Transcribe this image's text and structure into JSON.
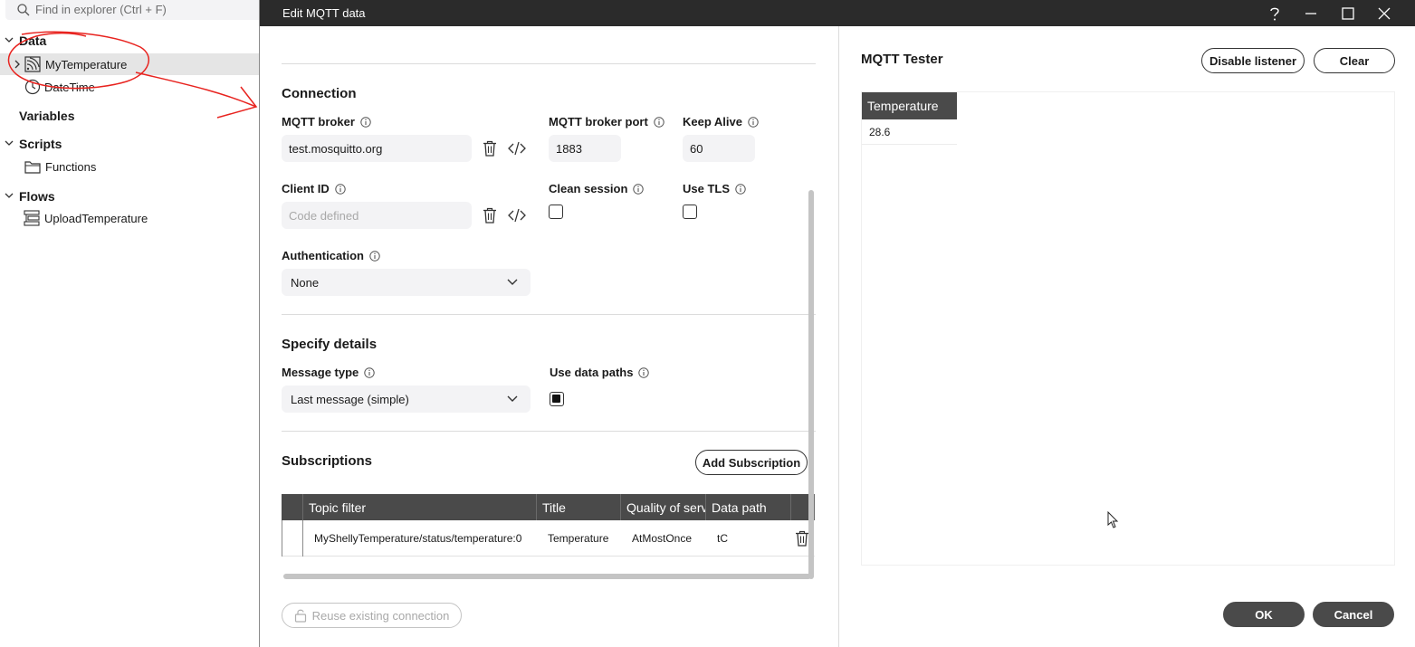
{
  "explorer": {
    "search_placeholder": "Find in explorer (Ctrl + F)",
    "sections": {
      "data": "Data",
      "variables": "Variables",
      "scripts": "Scripts",
      "flows": "Flows"
    },
    "items": {
      "my_temperature": "MyTemperature",
      "datetime": "DateTime",
      "functions": "Functions",
      "upload_temperature": "UploadTemperature"
    }
  },
  "dialog": {
    "title": "Edit MQTT data",
    "connection": {
      "section_title": "Connection",
      "broker_label": "MQTT broker",
      "broker_value": "test.mosquitto.org",
      "port_label": "MQTT broker port",
      "port_value": "1883",
      "keepalive_label": "Keep Alive",
      "keepalive_value": "60",
      "client_id_label": "Client ID",
      "client_id_placeholder": "Code defined",
      "clean_session_label": "Clean session",
      "clean_session_checked": false,
      "use_tls_label": "Use TLS",
      "use_tls_checked": false,
      "auth_label": "Authentication",
      "auth_value": "None"
    },
    "details": {
      "section_title": "Specify details",
      "message_type_label": "Message type",
      "message_type_value": "Last message (simple)",
      "use_data_paths_label": "Use data paths",
      "use_data_paths_checked": true
    },
    "subscriptions": {
      "section_title": "Subscriptions",
      "add_button": "Add Subscription",
      "columns": [
        "Topic filter",
        "Title",
        "Quality of service",
        "Data path"
      ],
      "rows": [
        {
          "topic": "MyShellyTemperature/status/temperature:0",
          "title": "Temperature",
          "qos": "AtMostOnce",
          "path": "tC"
        }
      ]
    },
    "reuse_connection": "Reuse existing connection",
    "tester": {
      "title": "MQTT Tester",
      "disable_button": "Disable listener",
      "clear_button": "Clear",
      "column": "Temperature",
      "value": "28.6"
    },
    "ok_button": "OK",
    "cancel_button": "Cancel"
  },
  "colors": {
    "titlebar": "#2b2b2b",
    "table_header": "#4a4a4a",
    "annotation": "#e8231f"
  }
}
